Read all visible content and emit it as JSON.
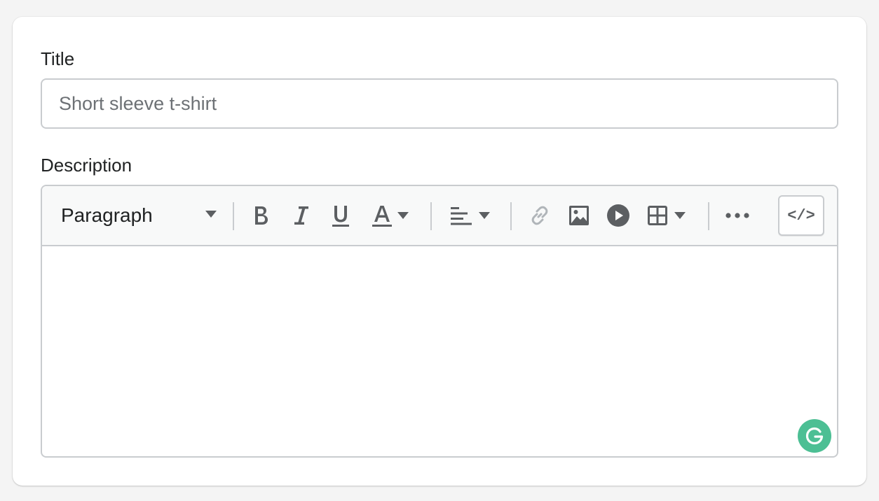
{
  "form": {
    "title_label": "Title",
    "title_placeholder": "Short sleeve t-shirt",
    "title_value": "",
    "description_label": "Description"
  },
  "toolbar": {
    "format_selected": "Paragraph",
    "code_label": "</>",
    "buttons": [
      {
        "name": "bold",
        "icon": "bold-icon"
      },
      {
        "name": "italic",
        "icon": "italic-icon"
      },
      {
        "name": "underline",
        "icon": "underline-icon"
      },
      {
        "name": "text-color",
        "icon": "text-color-icon",
        "dropdown": true
      },
      {
        "name": "align",
        "icon": "align-left-icon",
        "dropdown": true
      },
      {
        "name": "link",
        "icon": "link-icon",
        "disabled": true
      },
      {
        "name": "image",
        "icon": "image-icon"
      },
      {
        "name": "video",
        "icon": "play-circle-icon"
      },
      {
        "name": "table",
        "icon": "table-icon",
        "dropdown": true
      },
      {
        "name": "more",
        "icon": "more-horizontal-icon"
      },
      {
        "name": "show-html",
        "icon": "code-icon"
      }
    ]
  },
  "editor": {
    "content": ""
  },
  "extension": {
    "name": "Grammarly",
    "icon": "grammarly-icon"
  },
  "colors": {
    "background": "#f4f4f4",
    "card": "#ffffff",
    "border": "#c9cccf",
    "toolbar_bg": "#f8f9f9",
    "icon": "#5c5f62",
    "icon_disabled": "#b0b5b9",
    "text": "#202223",
    "placeholder": "#6d7175",
    "grammarly": "#4cbf94"
  }
}
